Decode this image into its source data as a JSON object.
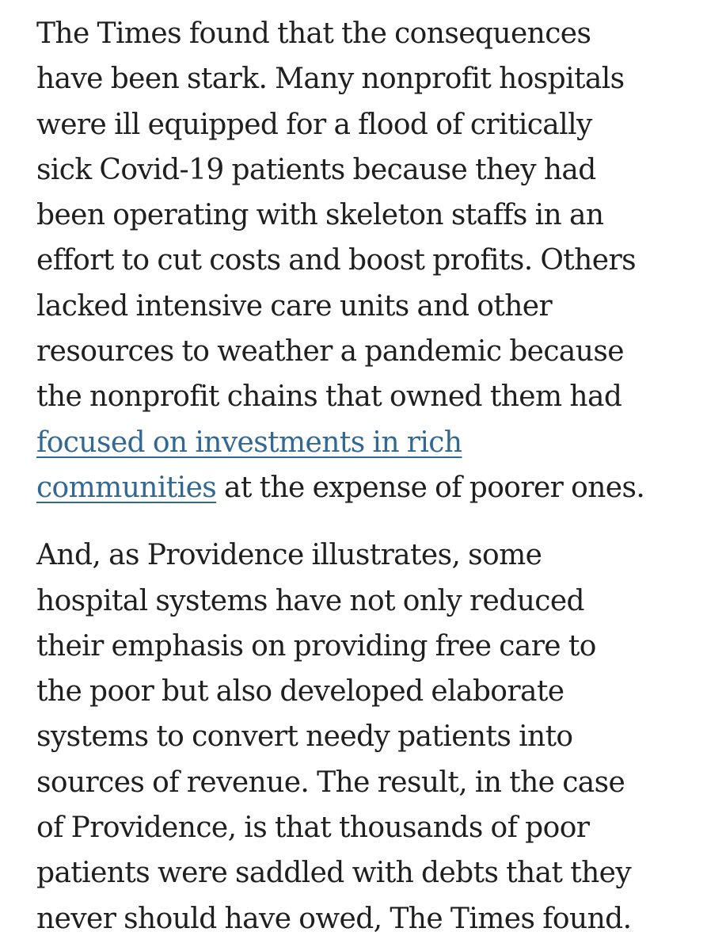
{
  "article": {
    "paragraph_1": {
      "lines": [
        "The Times found that the consequences",
        "have been stark. Many nonprofit hospitals",
        "were ill equipped for a flood of critically",
        "sick Covid-19 patients because they had",
        "been operating with skeleton staffs in an",
        "effort to cut costs and boost profits. Others",
        "lacked intensive care units and other",
        "resources to weather a pandemic because",
        "the nonprofit chains that owned them had"
      ],
      "link_line_1": "focused on investments in rich",
      "link_line_2": "communities",
      "after_link": " at the expense of poorer ones."
    },
    "paragraph_2": {
      "lines": [
        "And, as Providence illustrates, some",
        "hospital systems have not only reduced",
        "their emphasis on providing free care to",
        "the poor but also developed elaborate",
        "systems to convert needy patients into",
        "sources of revenue. The result, in the case",
        "of Providence, is that thousands of poor",
        "patients were saddled with debts that they",
        "never should have owed, The Times found."
      ]
    },
    "colors": {
      "text": "#1f1f1f",
      "link": "#326891",
      "background": "#ffffff"
    }
  }
}
